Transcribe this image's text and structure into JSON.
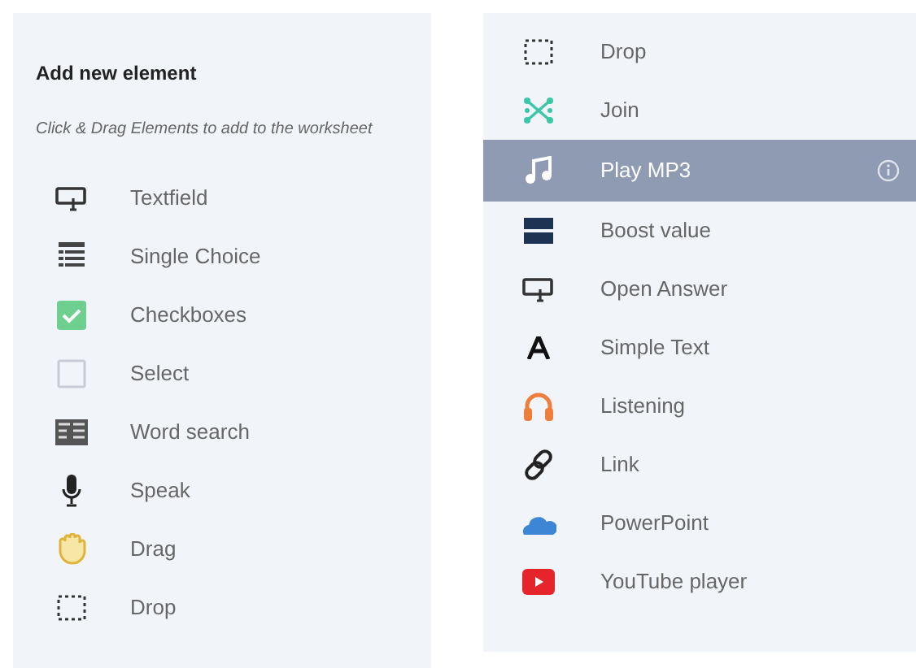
{
  "left_panel": {
    "title": "Add new element",
    "hint": "Click & Drag Elements to add to the worksheet",
    "items": [
      {
        "kind": "textfield",
        "label": "Textfield",
        "selected": false
      },
      {
        "kind": "single-choice",
        "label": "Single Choice",
        "selected": false
      },
      {
        "kind": "checkboxes",
        "label": "Checkboxes",
        "selected": false
      },
      {
        "kind": "select",
        "label": "Select",
        "selected": false
      },
      {
        "kind": "word-search",
        "label": "Word search",
        "selected": false
      },
      {
        "kind": "speak",
        "label": "Speak",
        "selected": false
      },
      {
        "kind": "drag",
        "label": "Drag",
        "selected": false
      },
      {
        "kind": "drop",
        "label": "Drop",
        "selected": false
      }
    ]
  },
  "right_panel": {
    "items": [
      {
        "kind": "drop",
        "label": "Drop",
        "selected": false
      },
      {
        "kind": "join",
        "label": "Join",
        "selected": false
      },
      {
        "kind": "mp3",
        "label": "Play MP3",
        "selected": true
      },
      {
        "kind": "boost",
        "label": "Boost value",
        "selected": false
      },
      {
        "kind": "textfield",
        "label": "Open Answer",
        "selected": false
      },
      {
        "kind": "text",
        "label": "Simple Text",
        "selected": false
      },
      {
        "kind": "listening",
        "label": "Listening",
        "selected": false
      },
      {
        "kind": "link",
        "label": "Link",
        "selected": false
      },
      {
        "kind": "powerpoint",
        "label": "PowerPoint",
        "selected": false
      },
      {
        "kind": "youtube",
        "label": "YouTube player",
        "selected": false
      }
    ]
  }
}
